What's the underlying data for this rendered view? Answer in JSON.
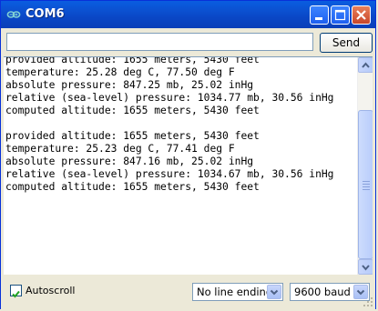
{
  "window": {
    "title": "COM6",
    "colors": {
      "titlebar": "#0a47c6",
      "close": "#c8462a",
      "frame": "#0831d9"
    }
  },
  "send": {
    "input_value": "",
    "button_label": "Send"
  },
  "output": {
    "lines": [
      "provided altitude: 1655 meters, 5430 feet",
      "temperature: 25.28 deg C, 77.50 deg F",
      "absolute pressure: 847.25 mb, 25.02 inHg",
      "relative (sea-level) pressure: 1034.77 mb, 30.56 inHg",
      "computed altitude: 1655 meters, 5430 feet",
      "",
      "provided altitude: 1655 meters, 5430 feet",
      "temperature: 25.23 deg C, 77.41 deg F",
      "absolute pressure: 847.16 mb, 25.02 inHg",
      "relative (sea-level) pressure: 1034.67 mb, 30.56 inHg",
      "computed altitude: 1655 meters, 5430 feet"
    ],
    "scroll_position": 0.9
  },
  "footer": {
    "autoscroll_label": "Autoscroll",
    "autoscroll_checked": true,
    "line_ending": "No line ending",
    "baud": "9600 baud"
  }
}
